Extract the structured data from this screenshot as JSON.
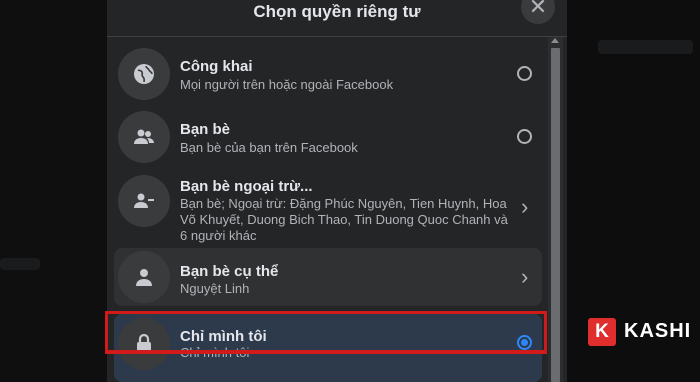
{
  "dialog": {
    "title": "Chọn quyền riêng tư",
    "close_icon": "close-icon"
  },
  "options": [
    {
      "title": "Công khai",
      "desc": "Mọi người trên hoặc ngoài Facebook",
      "icon": "globe-icon",
      "control": "radio",
      "selected": false
    },
    {
      "title": "Bạn bè",
      "desc": "Bạn bè của bạn trên Facebook",
      "icon": "friends-icon",
      "control": "radio",
      "selected": false
    },
    {
      "title": "Bạn bè ngoại trừ...",
      "desc": "Bạn bè; Ngoại trừ: Đặng Phúc Nguyên, Tien Huynh, Hoa Võ Khuyết, Duong Bich Thao, Tin Duong Quoc Chanh và 6 người khác",
      "icon": "friends-except-icon",
      "control": "chevron",
      "selected": false
    },
    {
      "title": "Bạn bè cụ thể",
      "desc": "Nguyệt Linh",
      "icon": "person-icon",
      "control": "chevron",
      "selected": false
    },
    {
      "title": "Chỉ mình tôi",
      "desc": "Chỉ mình tôi",
      "icon": "lock-icon",
      "control": "radio",
      "selected": true
    }
  ],
  "colors": {
    "dialog_bg": "#242526",
    "accent": "#2d88ff",
    "highlight": "#d11a1a",
    "logo_red": "#e02d2d"
  },
  "logo": {
    "badge": "K",
    "text": "KASHI"
  }
}
